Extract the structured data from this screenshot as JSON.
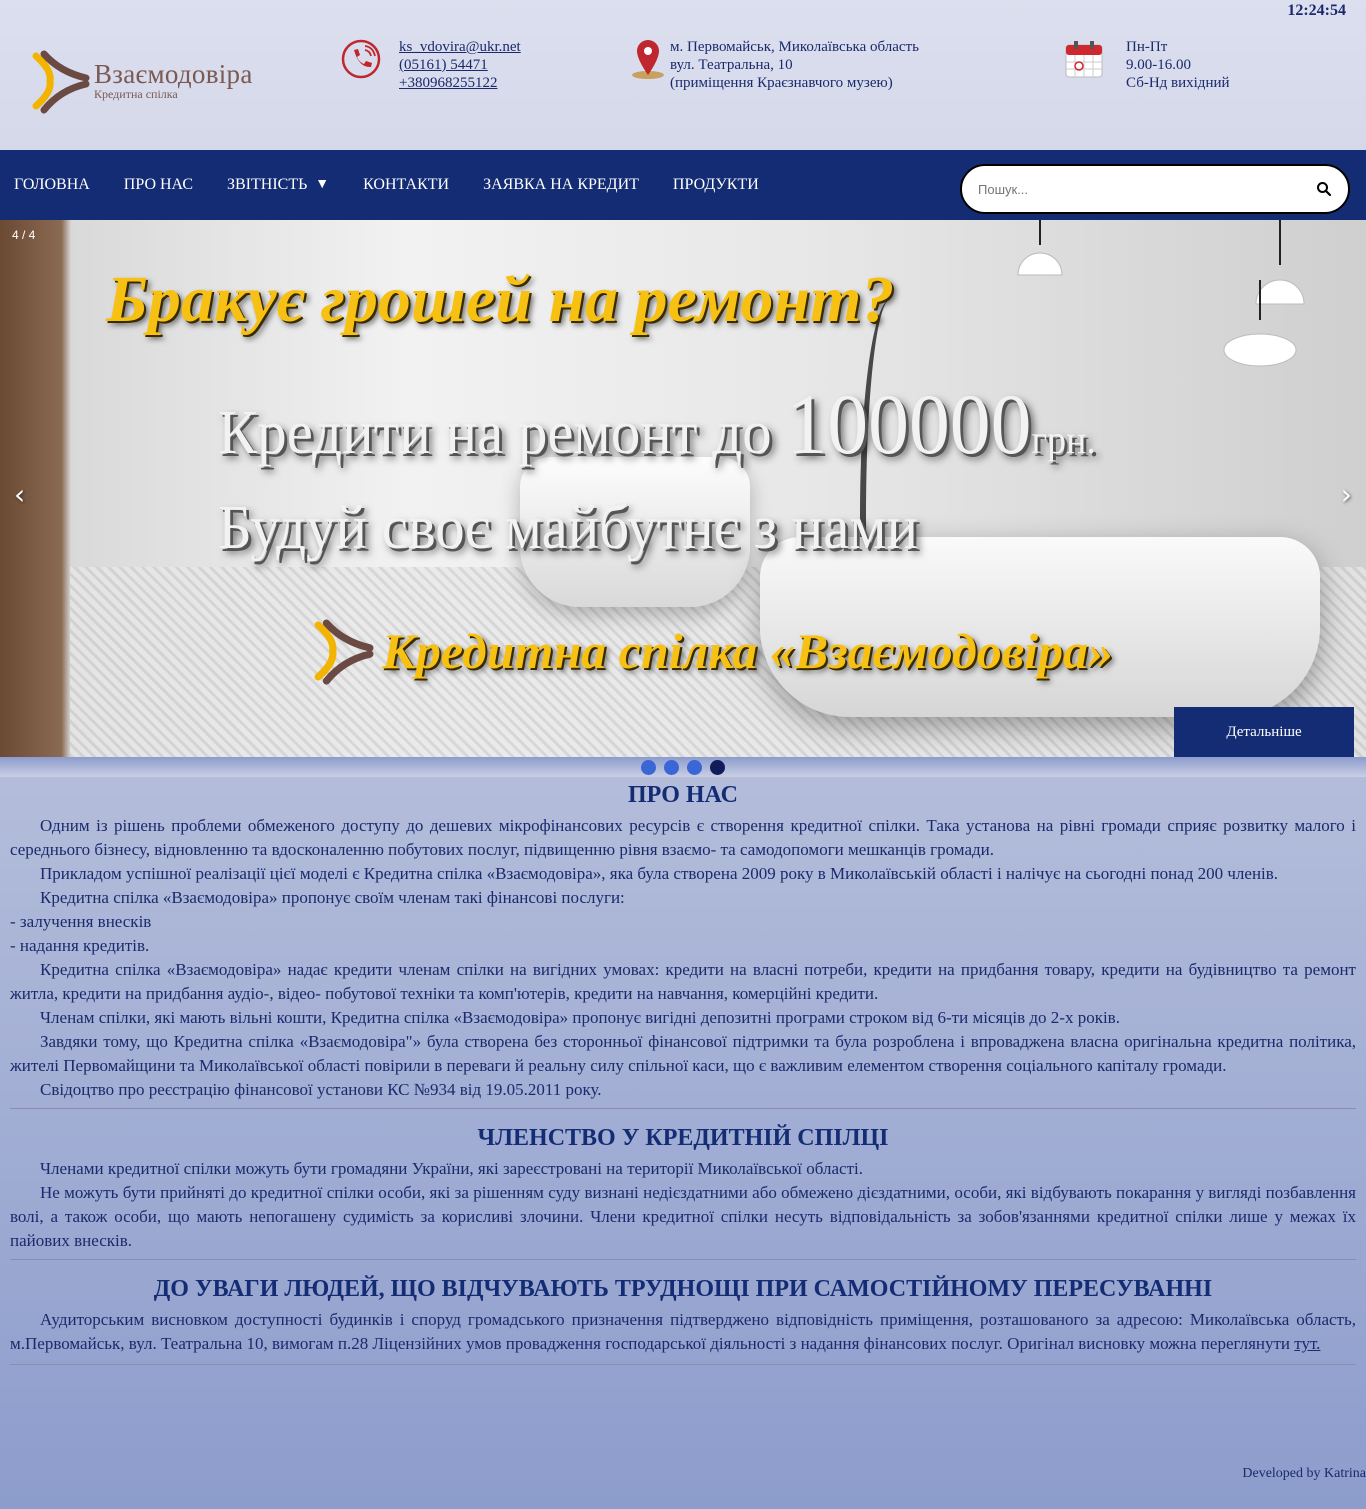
{
  "clock": "12:24:54",
  "logo": {
    "title": "Взаємодовіра",
    "subtitle": "Кредитна спілка"
  },
  "contacts": {
    "email": "ks_vdovira@ukr.net",
    "phone_city": "(05161) 54471",
    "phone_mobile": "+380968255122",
    "address_line1": "м. Первомайськ, Миколаївська область",
    "address_line2": "вул. Театральна, 10",
    "address_line3": "(приміщення Краєзнавчого музею)",
    "hours_line1": "Пн-Пт",
    "hours_line2": "9.00-16.00",
    "hours_line3": "Сб-Нд вихідний"
  },
  "nav": {
    "items": [
      "ГОЛОВНА",
      "ПРО НАС",
      "ЗВІТНІСТЬ",
      "КОНТАКТИ",
      "ЗАЯВКА НА КРЕДИТ",
      "ПРОДУКТИ"
    ],
    "dropdown_caret": "▼",
    "search_placeholder": "Пошук..."
  },
  "slider": {
    "counter": "4 / 4",
    "headline": "Бракує грошей на ремонт?",
    "line1_text": "Кредити на ремонт до ",
    "line1_amount": "100000",
    "line1_unit": "грн.",
    "line2": "Будуй своє майбутнє з нами",
    "brand": "Кредитна спілка «Взаємодовіра»",
    "prev_arrow": "‹",
    "next_arrow": "›",
    "more_button": "Детальніше",
    "dots_total": 4,
    "active_dot": 4
  },
  "about": {
    "title": "ПРО НАС",
    "p1": "Одним із рішень проблеми обмеженого доступу до дешевих мікрофінансових ресурсів є створення кредитної спілки. Така установа на рівні громади сприяє розвитку малого і середнього бізнесу, відновленню та вдосконаленню побутових послуг, підвищенню рівня взаємо- та самодопомоги мешканців громади.",
    "p2": "Прикладом успішної реалізації цієї моделі є Кредитна спілка «Взаємодовіра», яка була створена 2009 року в Миколаївській області і налічує на сьогодні понад 200 членів.",
    "p3": "Кредитна спілка «Взаємодовіра» пропонує своїм членам такі фінансові послуги:",
    "list1": "- залучення внесків",
    "list2": "- надання кредитів.",
    "p4": "Кредитна спілка «Взаємодовіра» надає кредити членам спілки на вигідних умовах: кредити на власні потреби, кредити на придбання товару, кредити на будівництво та ремонт житла, кредити на придбання аудіо-, відео- побутової техніки та комп'ютерів, кредити на навчання, комерційні кредити.",
    "p5": "Членам спілки, які мають вільні кошти, Кредитна спілка «Взаємодовіра» пропонує вигідні депозитні програми строком від 6-ти місяців до 2-х років.",
    "p6": "Завдяки тому, що Кредитна спілка «Взаємодовіра\"» була створена без сторонньої фінансової підтримки та була розроблена і впроваджена власна оригінальна кредитна політика, жителі Первомайщини та Миколаївської області повірили в переваги й реальну силу спільної каси, що є важливим елементом створення соціального капіталу громади.",
    "p7": "Свідоцтво про реєстрацію фінансової установи КС №934 від 19.05.2011 року."
  },
  "membership": {
    "title": "ЧЛЕНСТВО У КРЕДИТНІЙ СПІЛЦІ",
    "p1": "Членами кредитної спілки можуть бути громадяни України, які зареєстровані на території Миколаївської області.",
    "p2": "Не можуть бути прийняті до кредитної спілки особи, які за рішенням суду визнані недієздатними або обмежено дієздатними, особи, які відбувають покарання у вигляді позбавлення волі, а також особи, що мають непогашену судимість за корисливі злочини. Члени кредитної спілки несуть відповідальність за зобов'язаннями кредитної спілки лише у межах їх пайових внесків."
  },
  "accessibility": {
    "title": "ДО УВАГИ ЛЮДЕЙ, ЩО ВІДЧУВАЮТЬ ТРУДНОЩІ ПРИ САМОСТІЙНОМУ ПЕРЕСУВАННІ",
    "p1": "Аудиторським висновком доступності будинків і споруд громадського призначення підтверджено відповідність приміщення, розташованого за адресою: Миколаївська область, м.Первомайськ, вул. Театральна 10, вимогам п.28 Ліцензійних умов провадження господарської діяльності з надання фінансових послуг. Оригінал висновку можна переглянути ",
    "link": "тут."
  },
  "footer": "Developed by Katrina"
}
